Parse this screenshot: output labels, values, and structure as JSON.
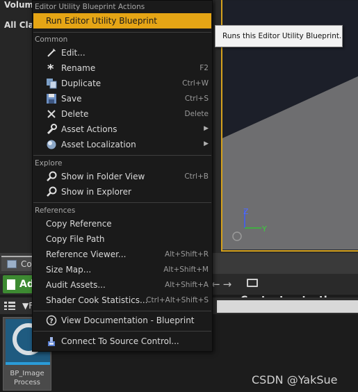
{
  "background": {
    "label_volume": "Volume",
    "label_all_classes": "All Clas",
    "content_tab": "Co",
    "add_button": "Ad",
    "nav_arrows": "←→",
    "path": {
      "root": "Content",
      "current": "testIma"
    },
    "filter_label": "F",
    "asset": {
      "name_line1": "BP_Image",
      "name_line2": "Process"
    },
    "axis": {
      "z": "Z",
      "y": "Y"
    },
    "watermark": "CSDN @YakSue"
  },
  "menu": {
    "header_top": "Editor Utility Blueprint Actions",
    "run_item": "Run Editor Utility Blueprint",
    "sections": {
      "common": "Common",
      "explore": "Explore",
      "references": "References"
    },
    "common_items": [
      {
        "label": "Edit...",
        "shortcut": "",
        "icon": "edit-icon"
      },
      {
        "label": "Rename",
        "shortcut": "F2",
        "icon": "rename-icon"
      },
      {
        "label": "Duplicate",
        "shortcut": "Ctrl+W",
        "icon": "duplicate-icon"
      },
      {
        "label": "Save",
        "shortcut": "Ctrl+S",
        "icon": "save-icon"
      },
      {
        "label": "Delete",
        "shortcut": "Delete",
        "icon": "delete-icon"
      },
      {
        "label": "Asset Actions",
        "shortcut": "",
        "icon": "wrench-icon",
        "submenu": true
      },
      {
        "label": "Asset Localization",
        "shortcut": "",
        "icon": "globe-icon",
        "submenu": true
      }
    ],
    "explore_items": [
      {
        "label": "Show in Folder View",
        "shortcut": "Ctrl+B",
        "icon": "magnifier-icon"
      },
      {
        "label": "Show in Explorer",
        "shortcut": "",
        "icon": "magnifier-icon"
      }
    ],
    "reference_items": [
      {
        "label": "Copy Reference",
        "shortcut": ""
      },
      {
        "label": "Copy File Path",
        "shortcut": ""
      },
      {
        "label": "Reference Viewer...",
        "shortcut": "Alt+Shift+R"
      },
      {
        "label": "Size Map...",
        "shortcut": "Alt+Shift+M"
      },
      {
        "label": "Audit Assets...",
        "shortcut": "Alt+Shift+A"
      },
      {
        "label": "Shader Cook Statistics...",
        "shortcut": "Ctrl+Alt+Shift+S"
      }
    ],
    "view_docs": "View Documentation - Blueprint",
    "source_control": "Connect To Source Control..."
  },
  "tooltip": {
    "text": "Runs this Editor Utility Blueprint."
  },
  "colors": {
    "highlight": "#e5a515",
    "menu_bg": "#1a1a1a",
    "viewport_border": "#d6a21c"
  }
}
